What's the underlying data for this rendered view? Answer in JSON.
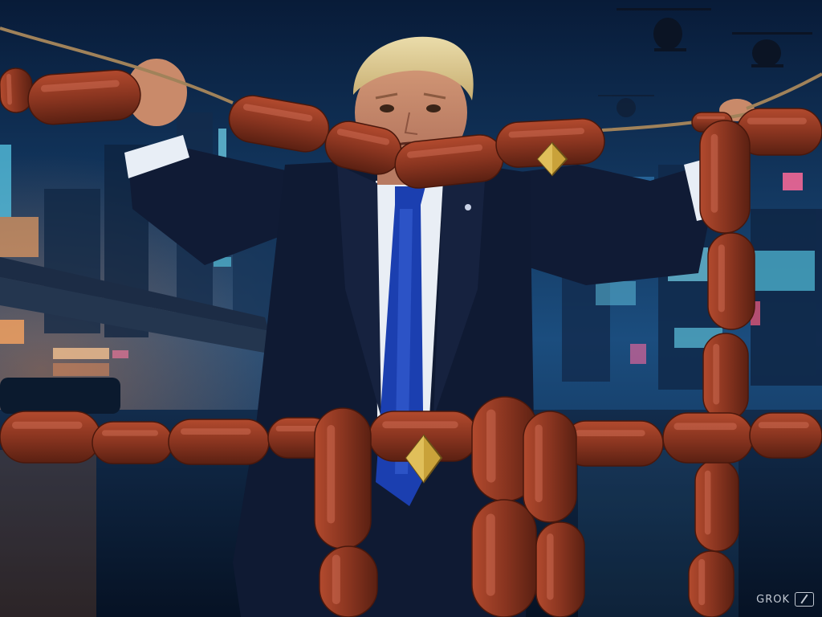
{
  "watermark": {
    "text": "GROK"
  },
  "colors": {
    "sky_top": "#0a1e3c",
    "sky_bottom": "#1a4a7a",
    "suit": "#0f1a33",
    "tie": "#1b3fb0",
    "sausage": "#8a3520",
    "rope": "#a0825a",
    "emblem_gold": "#c9a23a",
    "hair": "#d8c690"
  },
  "scene": {
    "subjects": [
      "man-in-suit",
      "sausage-garland",
      "helicopter",
      "helicopter",
      "helicopter",
      "city-skyline",
      "bridge",
      "wet-street"
    ],
    "emblems": [
      "ethereum-diamond",
      "ethereum-diamond"
    ]
  }
}
